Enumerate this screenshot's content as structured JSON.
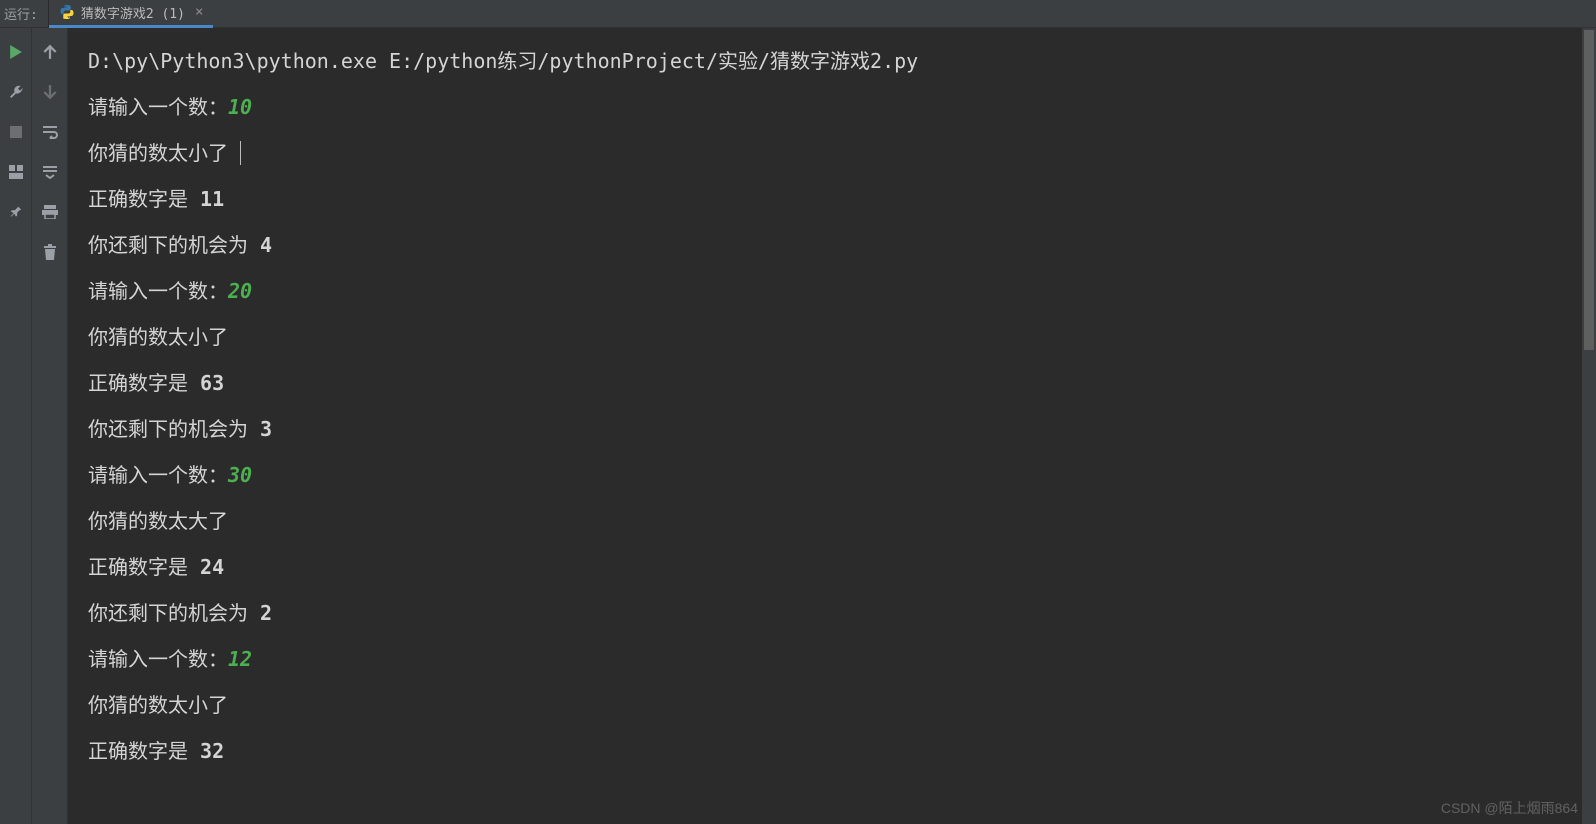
{
  "topbar": {
    "run_label": "运行:",
    "tab_title": "猜数字游戏2 (1)"
  },
  "console": {
    "cmd": "D:\\py\\Python3\\python.exe E:/python练习/pythonProject/实验/猜数字游戏2.py",
    "lines": [
      {
        "type": "prompt",
        "label": "请输入一个数：",
        "input": "10"
      },
      {
        "type": "plain_cursor",
        "text": "你猜的数太小了"
      },
      {
        "type": "result",
        "label": "正确数字是 ",
        "value": "11"
      },
      {
        "type": "result",
        "label": "你还剩下的机会为 ",
        "value": "4"
      },
      {
        "type": "prompt",
        "label": "请输入一个数：",
        "input": "20"
      },
      {
        "type": "plain",
        "text": "你猜的数太小了"
      },
      {
        "type": "result",
        "label": "正确数字是 ",
        "value": "63"
      },
      {
        "type": "result",
        "label": "你还剩下的机会为 ",
        "value": "3"
      },
      {
        "type": "prompt",
        "label": "请输入一个数：",
        "input": "30"
      },
      {
        "type": "plain",
        "text": "你猜的数太大了"
      },
      {
        "type": "result",
        "label": "正确数字是 ",
        "value": "24"
      },
      {
        "type": "result",
        "label": "你还剩下的机会为 ",
        "value": "2"
      },
      {
        "type": "prompt",
        "label": "请输入一个数：",
        "input": "12"
      },
      {
        "type": "plain",
        "text": "你猜的数太小了"
      },
      {
        "type": "result",
        "label": "正确数字是 ",
        "value": "32"
      }
    ]
  },
  "watermark": "CSDN @陌上烟雨864"
}
